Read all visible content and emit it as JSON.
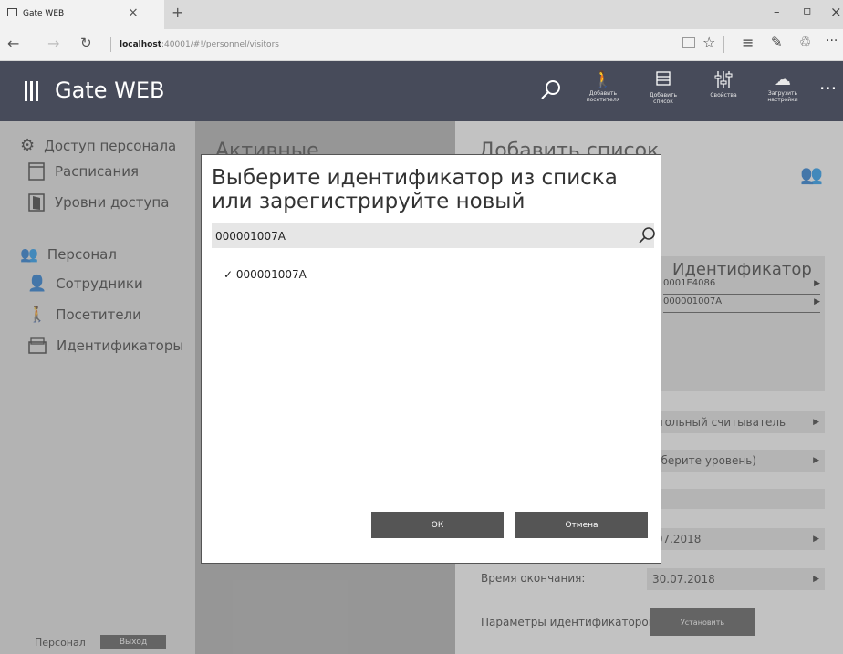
{
  "browser": {
    "tab_title": "Gate WEB",
    "tab_close": "×",
    "new_tab": "+",
    "url_host": "localhost",
    "url_rest": ":40001/#!/personnel/visitors",
    "win_min": "–",
    "win_max": "▫",
    "win_close": "×"
  },
  "app": {
    "title": "Gate WEB",
    "toolbar": [
      {
        "label1": "Добавить",
        "label2": "посетителя"
      },
      {
        "label1": "Добавить",
        "label2": "список"
      },
      {
        "label1": "Свойства",
        "label2": ""
      },
      {
        "label1": "Загрузить",
        "label2": "настройки"
      }
    ],
    "more": "···"
  },
  "sidebar": {
    "group1": "Доступ персонала",
    "items1": [
      "Расписания",
      "Уровни доступа"
    ],
    "group2": "Персонал",
    "items2": [
      "Сотрудники",
      "Посетители",
      "Идентификаторы"
    ],
    "footer_label": "Персонал",
    "logout": "Выход"
  },
  "middle": {
    "title": "Активные"
  },
  "right": {
    "title": "Добавить список",
    "id_header": "Идентификатор",
    "id_rows": [
      "0001E4086",
      "000001007A"
    ],
    "reader": "стольный считыватель",
    "level": "ыберите уровень)",
    "start_date": ".07.2018",
    "end_label": "Время окончания:",
    "end_date": "30.07.2018",
    "params_label": "Параметры идентификаторов",
    "set_button": "Установить"
  },
  "dialog": {
    "title_line1": "Выберите идентификатор из списка",
    "title_line2": "или зарегистрируйте новый",
    "search_value": "000001007A",
    "items": [
      {
        "check": "✓",
        "label": "000001007A"
      }
    ],
    "ok": "ОК",
    "cancel": "Отмена"
  }
}
